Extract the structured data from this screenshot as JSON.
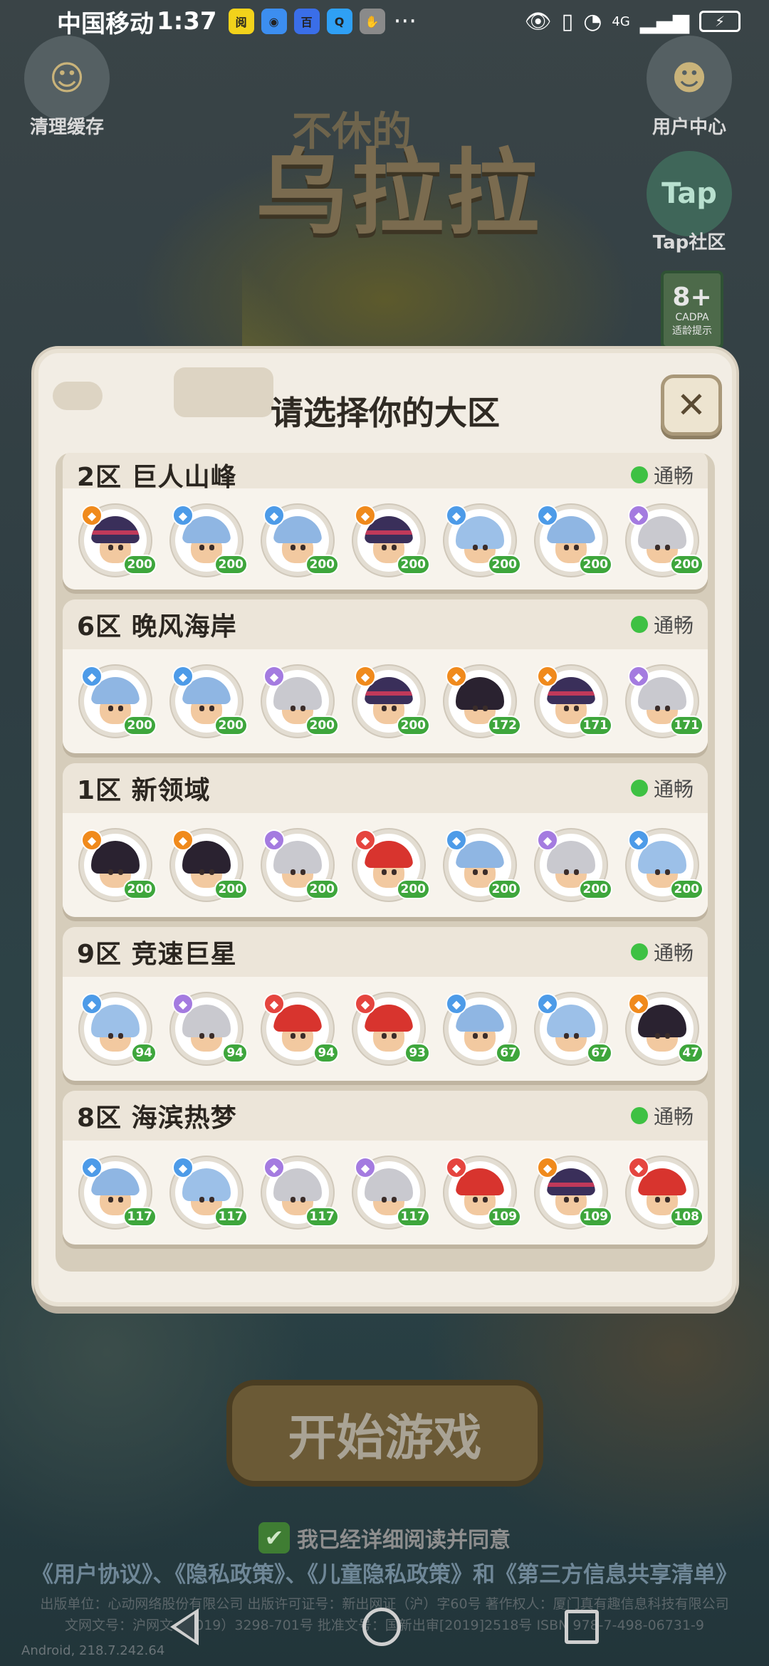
{
  "status_bar": {
    "carrier": "中国移动",
    "time": "1:37",
    "apps": [
      {
        "icon": "news-app-icon",
        "text": "阅",
        "color": "#f2d21b"
      },
      {
        "icon": "browser-app-icon",
        "text": "◉",
        "color": "#3c8ef0"
      },
      {
        "icon": "baidu-app-icon",
        "text": "百",
        "color": "#3a6ee8"
      },
      {
        "icon": "search-app-icon",
        "text": "Q",
        "color": "#2fa0f5"
      },
      {
        "icon": "gesture-app-icon",
        "text": "✋",
        "color": "#8a8a8a"
      }
    ],
    "more": "···",
    "network": "4G",
    "battery": "⚡"
  },
  "background": {
    "clear_cache_label": "清理缓存",
    "user_center_label": "用户中心",
    "tap_label": "Tap社区",
    "tap_logo": "Tap",
    "title_small": "不休的",
    "title_big": "乌拉拉",
    "age_rating": "8+",
    "age_org": "CADPA",
    "age_note": "适龄提示",
    "start_button": "开始游戏",
    "agree_text": "我已经详细阅读并同意",
    "agree_links": "《用户协议》、《隐私政策》、《儿童隐私政策》和《第三方信息共享清单》",
    "publisher_line1": "出版单位：心动网络股份有限公司 出版许可证号：新出网证（沪）字60号 著作权人：厦门真有趣信息科技有限公司",
    "publisher_line2": "文网文号：沪网文（2019）3298-701号 批准文号：国新出审[2019]2518号 ISBN 978-7-498-06731-9",
    "version": "Android, 218.7.242.64"
  },
  "modal": {
    "title": "请选择你的大区",
    "close": "✕",
    "servers": [
      {
        "name": "2区  巨人山峰",
        "status": "通畅",
        "heroes": [
          {
            "type": "warrior",
            "level": "200"
          },
          {
            "type": "mage",
            "level": "200"
          },
          {
            "type": "mage",
            "level": "200"
          },
          {
            "type": "warrior",
            "level": "200"
          },
          {
            "type": "mage-long",
            "level": "200"
          },
          {
            "type": "mage",
            "level": "200"
          },
          {
            "type": "silver",
            "level": "200"
          }
        ]
      },
      {
        "name": "6区  晚风海岸",
        "status": "通畅",
        "heroes": [
          {
            "type": "mage",
            "level": "200"
          },
          {
            "type": "mage",
            "level": "200"
          },
          {
            "type": "silver",
            "level": "200"
          },
          {
            "type": "warrior",
            "level": "200"
          },
          {
            "type": "dark",
            "level": "172"
          },
          {
            "type": "warrior",
            "level": "171"
          },
          {
            "type": "silver",
            "level": "171"
          }
        ]
      },
      {
        "name": "1区  新领域",
        "status": "通畅",
        "heroes": [
          {
            "type": "dark",
            "level": "200"
          },
          {
            "type": "dark",
            "level": "200"
          },
          {
            "type": "silver",
            "level": "200"
          },
          {
            "type": "red",
            "level": "200"
          },
          {
            "type": "mage",
            "level": "200"
          },
          {
            "type": "silver",
            "level": "200"
          },
          {
            "type": "mage-long",
            "level": "200"
          }
        ]
      },
      {
        "name": "9区  竞速巨星",
        "status": "通畅",
        "heroes": [
          {
            "type": "mage-long",
            "level": "94"
          },
          {
            "type": "silver",
            "level": "94"
          },
          {
            "type": "red",
            "level": "94"
          },
          {
            "type": "red",
            "level": "93"
          },
          {
            "type": "mage",
            "level": "67"
          },
          {
            "type": "mage-long",
            "level": "67"
          },
          {
            "type": "dark",
            "level": "47"
          }
        ]
      },
      {
        "name": "8区  海滨热梦",
        "status": "通畅",
        "heroes": [
          {
            "type": "mage",
            "level": "117"
          },
          {
            "type": "mage-long",
            "level": "117"
          },
          {
            "type": "silver",
            "level": "117"
          },
          {
            "type": "silver",
            "level": "117"
          },
          {
            "type": "red",
            "level": "109"
          },
          {
            "type": "warrior",
            "level": "109"
          },
          {
            "type": "red",
            "level": "108"
          }
        ]
      }
    ]
  },
  "hero_styles": {
    "warrior": {
      "hair": "#3a2f5a",
      "badge": "#f08a1c",
      "band": true
    },
    "mage": {
      "hair": "#8fb6e3",
      "badge": "#4d9be8",
      "band": false
    },
    "mage-long": {
      "hair": "#9cc0e8",
      "badge": "#4d9be8",
      "band": false
    },
    "silver": {
      "hair": "#c9c9cf",
      "badge": "#a47be0",
      "band": false
    },
    "dark": {
      "hair": "#2a2230",
      "badge": "#f08a1c",
      "band": false
    },
    "red": {
      "hair": "#d8342e",
      "badge": "#e5453f",
      "band": false
    }
  },
  "colors": {
    "status_ok": "#3ec143",
    "level_badge": "#3ea63c"
  }
}
